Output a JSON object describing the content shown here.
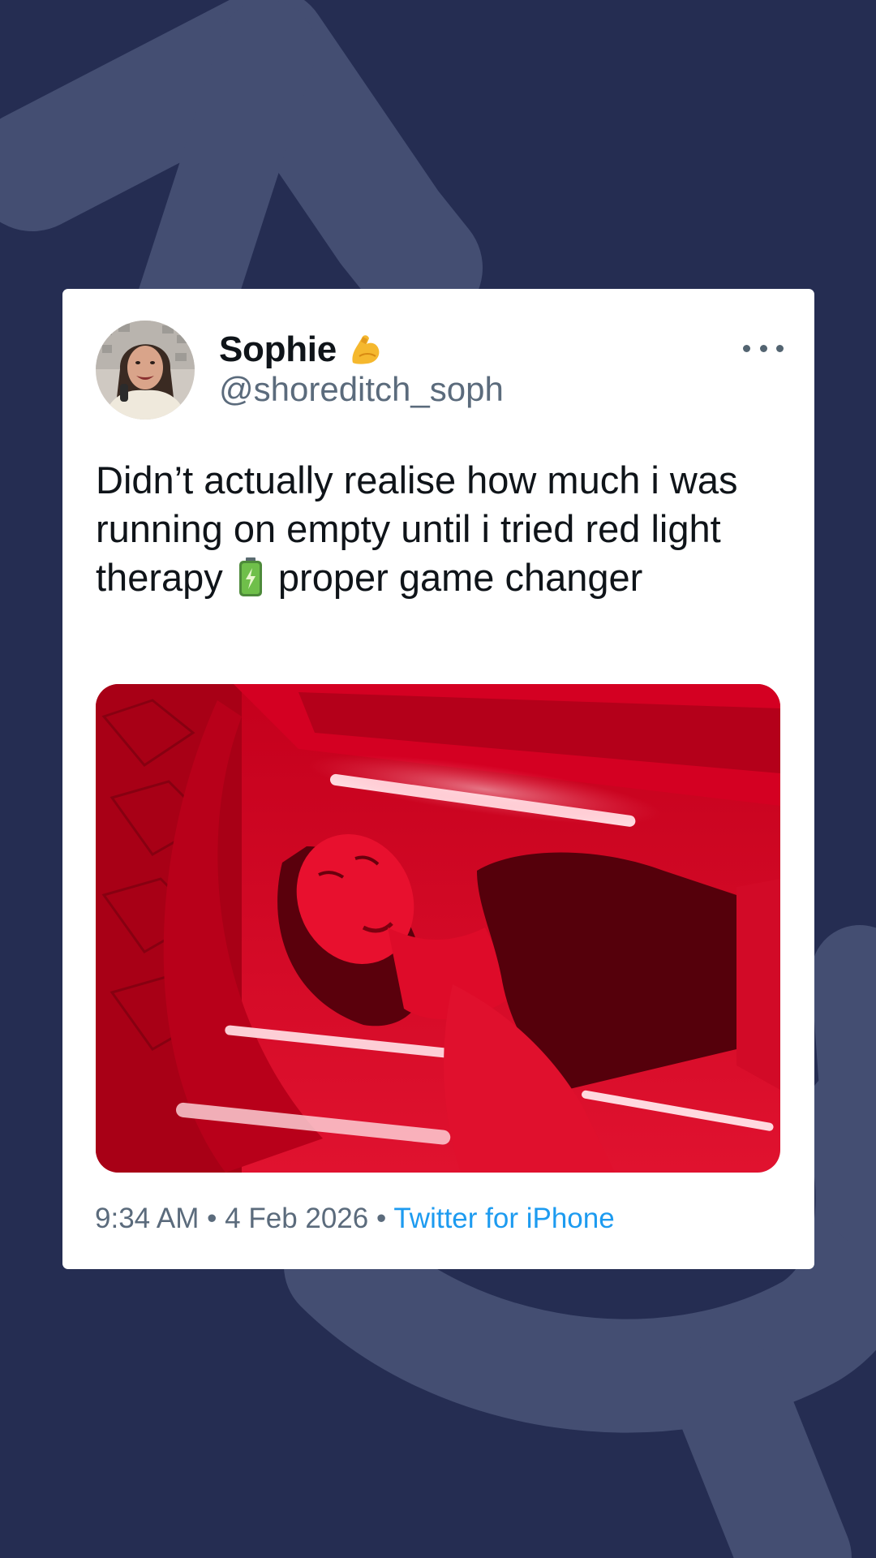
{
  "tweet": {
    "display_name": "Sophie",
    "name_emoji": "flexed-biceps-icon",
    "handle": "@shoreditch_soph",
    "more_icon": "more-options-icon",
    "text_part1": "Didn’t actually realise how much i was running on empty until i tried red light therapy",
    "text_emoji": "battery-icon",
    "text_part2": "proper game changer",
    "time": "9:34 AM",
    "separator": "•",
    "date": "4 Feb 2026",
    "source": "Twitter for iPhone"
  },
  "colors": {
    "background": "#252d52",
    "card": "#ffffff",
    "link": "#1d9bf0",
    "secondary_text": "#5b6b7c"
  }
}
